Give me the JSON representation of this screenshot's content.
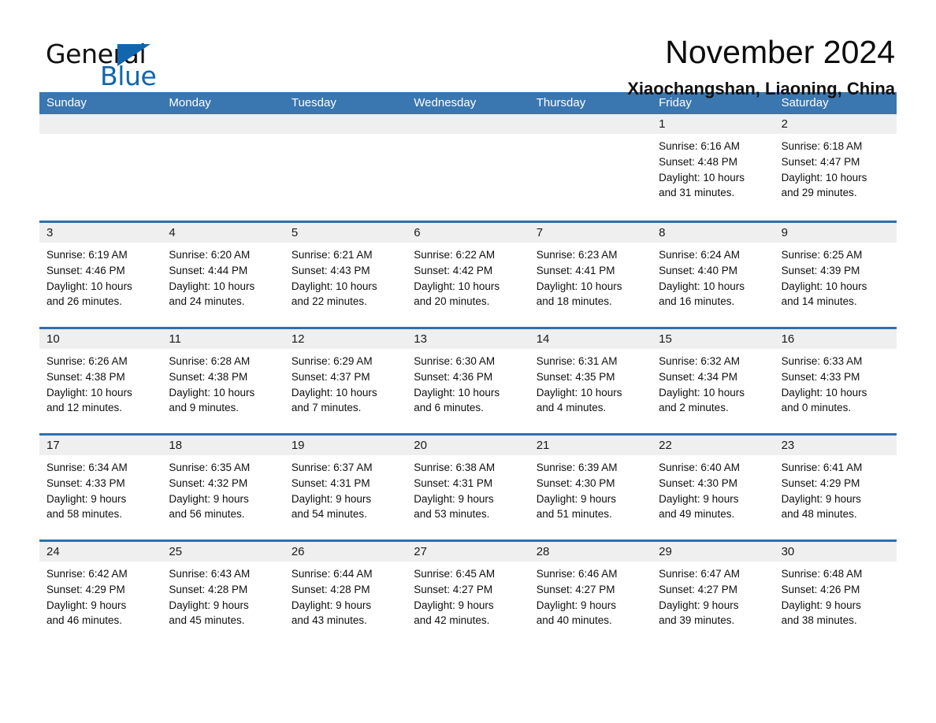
{
  "brand": {
    "name_part1": "General",
    "name_part2": "Blue",
    "accent_color": "#1266ad"
  },
  "header": {
    "title": "November 2024",
    "subtitle": "Xiaochangshan, Liaoning, China"
  },
  "calendar": {
    "header_bg": "#3a76b0",
    "row_separator_color": "#2f6fac",
    "day_band_bg": "#efefef",
    "weekdays": [
      "Sunday",
      "Monday",
      "Tuesday",
      "Wednesday",
      "Thursday",
      "Friday",
      "Saturday"
    ],
    "weeks": [
      [
        {
          "day": "",
          "lines": []
        },
        {
          "day": "",
          "lines": []
        },
        {
          "day": "",
          "lines": []
        },
        {
          "day": "",
          "lines": []
        },
        {
          "day": "",
          "lines": []
        },
        {
          "day": "1",
          "lines": [
            "Sunrise: 6:16 AM",
            "Sunset: 4:48 PM",
            "Daylight: 10 hours",
            "and 31 minutes."
          ]
        },
        {
          "day": "2",
          "lines": [
            "Sunrise: 6:18 AM",
            "Sunset: 4:47 PM",
            "Daylight: 10 hours",
            "and 29 minutes."
          ]
        }
      ],
      [
        {
          "day": "3",
          "lines": [
            "Sunrise: 6:19 AM",
            "Sunset: 4:46 PM",
            "Daylight: 10 hours",
            "and 26 minutes."
          ]
        },
        {
          "day": "4",
          "lines": [
            "Sunrise: 6:20 AM",
            "Sunset: 4:44 PM",
            "Daylight: 10 hours",
            "and 24 minutes."
          ]
        },
        {
          "day": "5",
          "lines": [
            "Sunrise: 6:21 AM",
            "Sunset: 4:43 PM",
            "Daylight: 10 hours",
            "and 22 minutes."
          ]
        },
        {
          "day": "6",
          "lines": [
            "Sunrise: 6:22 AM",
            "Sunset: 4:42 PM",
            "Daylight: 10 hours",
            "and 20 minutes."
          ]
        },
        {
          "day": "7",
          "lines": [
            "Sunrise: 6:23 AM",
            "Sunset: 4:41 PM",
            "Daylight: 10 hours",
            "and 18 minutes."
          ]
        },
        {
          "day": "8",
          "lines": [
            "Sunrise: 6:24 AM",
            "Sunset: 4:40 PM",
            "Daylight: 10 hours",
            "and 16 minutes."
          ]
        },
        {
          "day": "9",
          "lines": [
            "Sunrise: 6:25 AM",
            "Sunset: 4:39 PM",
            "Daylight: 10 hours",
            "and 14 minutes."
          ]
        }
      ],
      [
        {
          "day": "10",
          "lines": [
            "Sunrise: 6:26 AM",
            "Sunset: 4:38 PM",
            "Daylight: 10 hours",
            "and 12 minutes."
          ]
        },
        {
          "day": "11",
          "lines": [
            "Sunrise: 6:28 AM",
            "Sunset: 4:38 PM",
            "Daylight: 10 hours",
            "and 9 minutes."
          ]
        },
        {
          "day": "12",
          "lines": [
            "Sunrise: 6:29 AM",
            "Sunset: 4:37 PM",
            "Daylight: 10 hours",
            "and 7 minutes."
          ]
        },
        {
          "day": "13",
          "lines": [
            "Sunrise: 6:30 AM",
            "Sunset: 4:36 PM",
            "Daylight: 10 hours",
            "and 6 minutes."
          ]
        },
        {
          "day": "14",
          "lines": [
            "Sunrise: 6:31 AM",
            "Sunset: 4:35 PM",
            "Daylight: 10 hours",
            "and 4 minutes."
          ]
        },
        {
          "day": "15",
          "lines": [
            "Sunrise: 6:32 AM",
            "Sunset: 4:34 PM",
            "Daylight: 10 hours",
            "and 2 minutes."
          ]
        },
        {
          "day": "16",
          "lines": [
            "Sunrise: 6:33 AM",
            "Sunset: 4:33 PM",
            "Daylight: 10 hours",
            "and 0 minutes."
          ]
        }
      ],
      [
        {
          "day": "17",
          "lines": [
            "Sunrise: 6:34 AM",
            "Sunset: 4:33 PM",
            "Daylight: 9 hours",
            "and 58 minutes."
          ]
        },
        {
          "day": "18",
          "lines": [
            "Sunrise: 6:35 AM",
            "Sunset: 4:32 PM",
            "Daylight: 9 hours",
            "and 56 minutes."
          ]
        },
        {
          "day": "19",
          "lines": [
            "Sunrise: 6:37 AM",
            "Sunset: 4:31 PM",
            "Daylight: 9 hours",
            "and 54 minutes."
          ]
        },
        {
          "day": "20",
          "lines": [
            "Sunrise: 6:38 AM",
            "Sunset: 4:31 PM",
            "Daylight: 9 hours",
            "and 53 minutes."
          ]
        },
        {
          "day": "21",
          "lines": [
            "Sunrise: 6:39 AM",
            "Sunset: 4:30 PM",
            "Daylight: 9 hours",
            "and 51 minutes."
          ]
        },
        {
          "day": "22",
          "lines": [
            "Sunrise: 6:40 AM",
            "Sunset: 4:30 PM",
            "Daylight: 9 hours",
            "and 49 minutes."
          ]
        },
        {
          "day": "23",
          "lines": [
            "Sunrise: 6:41 AM",
            "Sunset: 4:29 PM",
            "Daylight: 9 hours",
            "and 48 minutes."
          ]
        }
      ],
      [
        {
          "day": "24",
          "lines": [
            "Sunrise: 6:42 AM",
            "Sunset: 4:29 PM",
            "Daylight: 9 hours",
            "and 46 minutes."
          ]
        },
        {
          "day": "25",
          "lines": [
            "Sunrise: 6:43 AM",
            "Sunset: 4:28 PM",
            "Daylight: 9 hours",
            "and 45 minutes."
          ]
        },
        {
          "day": "26",
          "lines": [
            "Sunrise: 6:44 AM",
            "Sunset: 4:28 PM",
            "Daylight: 9 hours",
            "and 43 minutes."
          ]
        },
        {
          "day": "27",
          "lines": [
            "Sunrise: 6:45 AM",
            "Sunset: 4:27 PM",
            "Daylight: 9 hours",
            "and 42 minutes."
          ]
        },
        {
          "day": "28",
          "lines": [
            "Sunrise: 6:46 AM",
            "Sunset: 4:27 PM",
            "Daylight: 9 hours",
            "and 40 minutes."
          ]
        },
        {
          "day": "29",
          "lines": [
            "Sunrise: 6:47 AM",
            "Sunset: 4:27 PM",
            "Daylight: 9 hours",
            "and 39 minutes."
          ]
        },
        {
          "day": "30",
          "lines": [
            "Sunrise: 6:48 AM",
            "Sunset: 4:26 PM",
            "Daylight: 9 hours",
            "and 38 minutes."
          ]
        }
      ]
    ]
  }
}
